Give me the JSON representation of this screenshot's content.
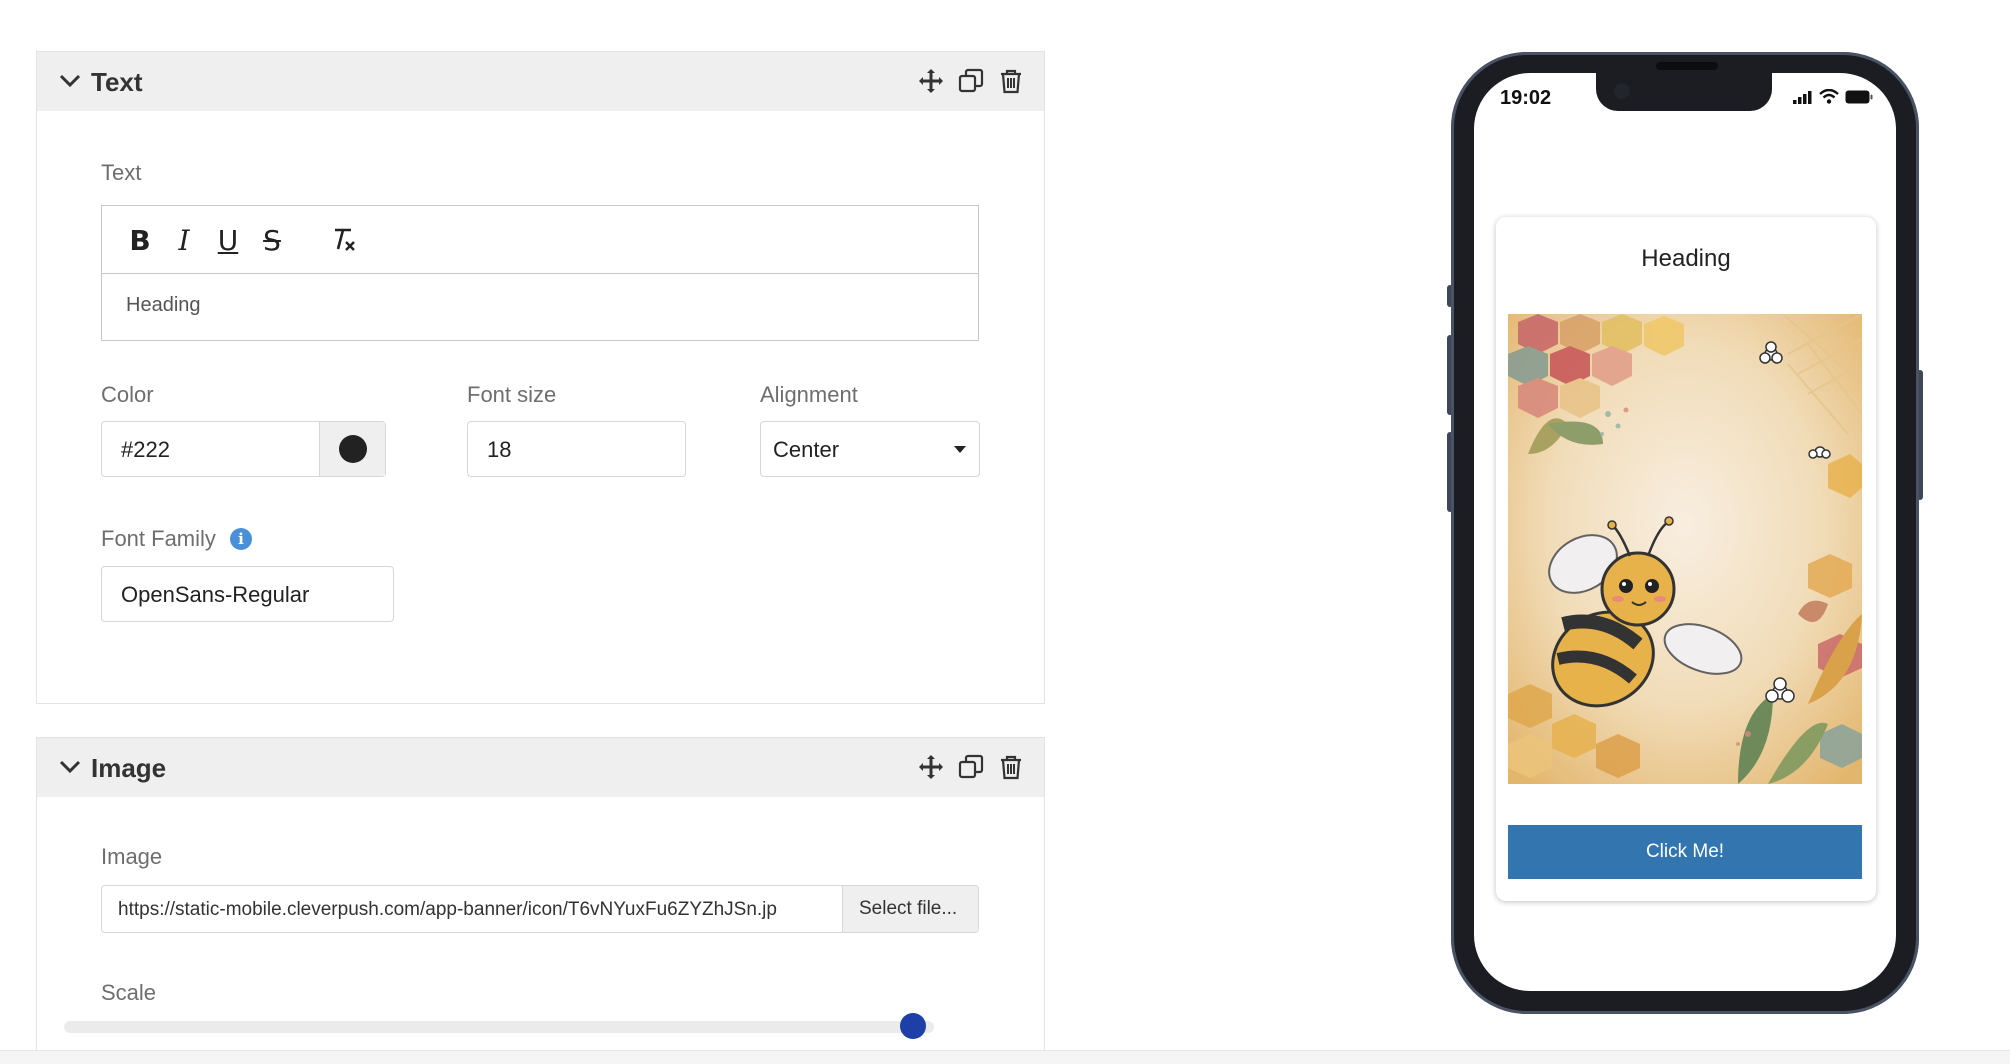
{
  "text_section": {
    "title": "Text",
    "text_label": "Text",
    "editor_content": "Heading",
    "color_label": "Color",
    "color_value": "#222",
    "font_size_label": "Font size",
    "font_size_value": "18",
    "alignment_label": "Alignment",
    "alignment_value": "Center",
    "font_family_label": "Font Family",
    "font_family_value": "OpenSans-Regular"
  },
  "image_section": {
    "title": "Image",
    "image_label": "Image",
    "image_url": "https://static-mobile.cleverpush.com/app-banner/icon/T6vNYuxFu6ZYZhJSn.jp",
    "select_file_label": "Select file...",
    "scale_label": "Scale",
    "scale_value_fraction": 0.99
  },
  "preview": {
    "status_time": "19:02",
    "heading": "Heading",
    "button_label": "Click Me!",
    "button_color": "#3375ae"
  },
  "colors": {
    "swatch": "#222222",
    "info_icon": "#4a90d9",
    "slider_thumb": "#1d3fa8"
  }
}
